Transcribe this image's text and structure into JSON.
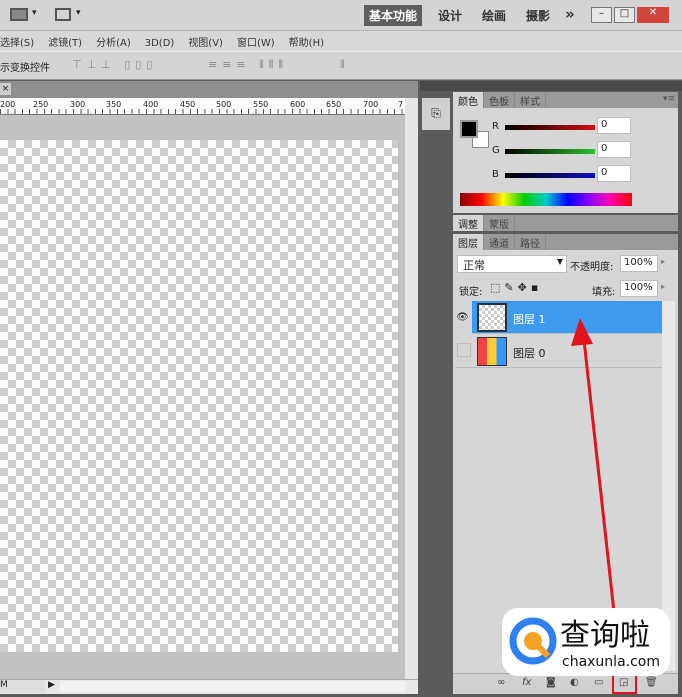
{
  "workspaces": {
    "active": "基本功能",
    "items": [
      "设计",
      "绘画",
      "摄影"
    ],
    "more": "»"
  },
  "window_controls": {
    "min": "–",
    "max": "□",
    "close": "✕"
  },
  "menu": [
    "选择(S)",
    "滤镜(T)",
    "分析(A)",
    "3D(D)",
    "视图(V)",
    "窗口(W)",
    "帮助(H)"
  ],
  "options": {
    "transform_label": "示变换控件"
  },
  "doc_tab_close": "×",
  "ruler": [
    "200",
    "250",
    "300",
    "350",
    "400",
    "450",
    "500",
    "550",
    "600",
    "650",
    "700",
    "7"
  ],
  "status": {
    "zoom": "M"
  },
  "color_panel": {
    "tabs": [
      "颜色",
      "色板",
      "样式"
    ],
    "r_label": "R",
    "g_label": "G",
    "b_label": "B",
    "r": "0",
    "g": "0",
    "b": "0"
  },
  "adjust_panel": {
    "tabs": [
      "调整",
      "蒙版"
    ]
  },
  "layers_panel": {
    "tabs": [
      "图层",
      "通道",
      "路径"
    ],
    "blend_mode": "正常",
    "opacity_label": "不透明度:",
    "opacity": "100%",
    "lock_label": "锁定:",
    "fill_label": "填充:",
    "fill": "100%",
    "layers": [
      {
        "name": "图层 1",
        "selected": true,
        "visible": true
      },
      {
        "name": "图层 0",
        "selected": false,
        "visible": false
      }
    ]
  },
  "bottom_buttons": [
    "link",
    "fx",
    "mask",
    "adjustment",
    "group",
    "new-layer",
    "delete"
  ],
  "watermark": {
    "title": "查询啦",
    "url": "chaxunla.com"
  },
  "colors": {
    "selection": "#3d9aef",
    "annotation": "#e0141a"
  }
}
